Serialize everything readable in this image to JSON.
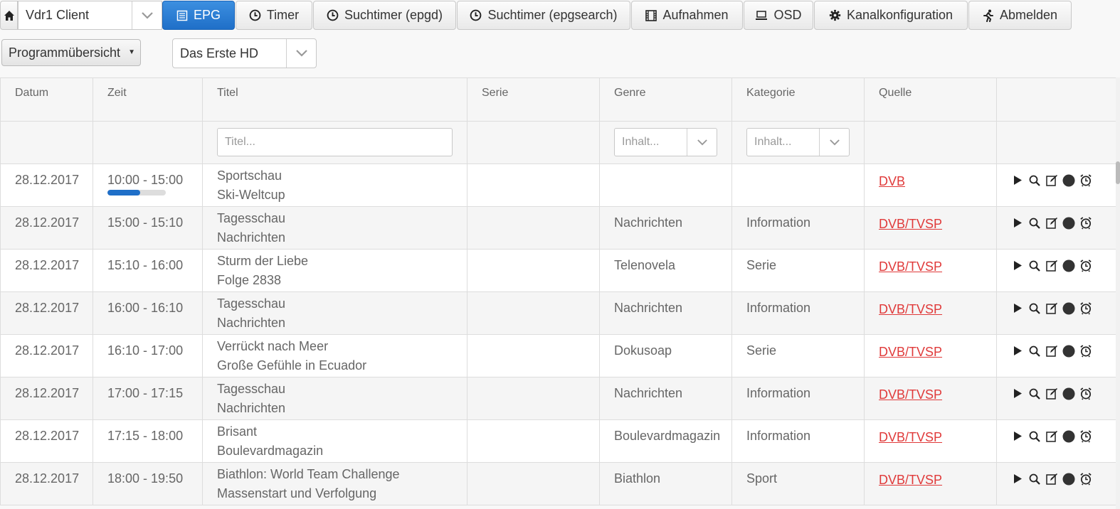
{
  "nav": {
    "client_select": "Vdr1 Client",
    "buttons": {
      "epg": "EPG",
      "timer": "Timer",
      "suchtimer_epgd": "Suchtimer (epgd)",
      "suchtimer_epgsearch": "Suchtimer (epgsearch)",
      "aufnahmen": "Aufnahmen",
      "osd": "OSD",
      "kanalkonfiguration": "Kanalkonfiguration",
      "abmelden": "Abmelden"
    }
  },
  "view_select": "Programmübersicht",
  "channel_select": "Das Erste HD",
  "table": {
    "headers": {
      "datum": "Datum",
      "zeit": "Zeit",
      "titel": "Titel",
      "serie": "Serie",
      "genre": "Genre",
      "kategorie": "Kategorie",
      "quelle": "Quelle"
    },
    "filters": {
      "titel_placeholder": "Titel...",
      "genre_placeholder": "Inhalt...",
      "kategorie_placeholder": "Inhalt..."
    },
    "rows": [
      {
        "datum": "28.12.2017",
        "zeit": "10:00 - 15:00",
        "progress": 0.56,
        "titel": "Sportschau",
        "untertitel": "Ski-Weltcup",
        "serie": "",
        "genre": "",
        "kategorie": "",
        "quelle": "DVB"
      },
      {
        "datum": "28.12.2017",
        "zeit": "15:00 - 15:10",
        "titel": "Tagesschau",
        "untertitel": "Nachrichten",
        "serie": "",
        "genre": "Nachrichten",
        "kategorie": "Information",
        "quelle": "DVB/TVSP"
      },
      {
        "datum": "28.12.2017",
        "zeit": "15:10 - 16:00",
        "titel": "Sturm der Liebe",
        "untertitel": "Folge 2838",
        "serie": "",
        "genre": "Telenovela",
        "kategorie": "Serie",
        "quelle": "DVB/TVSP"
      },
      {
        "datum": "28.12.2017",
        "zeit": "16:00 - 16:10",
        "titel": "Tagesschau",
        "untertitel": "Nachrichten",
        "serie": "",
        "genre": "Nachrichten",
        "kategorie": "Information",
        "quelle": "DVB/TVSP"
      },
      {
        "datum": "28.12.2017",
        "zeit": "16:10 - 17:00",
        "titel": "Verrückt nach Meer",
        "untertitel": "Große Gefühle in Ecuador",
        "serie": "",
        "genre": "Dokusoap",
        "kategorie": "Serie",
        "quelle": "DVB/TVSP"
      },
      {
        "datum": "28.12.2017",
        "zeit": "17:00 - 17:15",
        "titel": "Tagesschau",
        "untertitel": "Nachrichten",
        "serie": "",
        "genre": "Nachrichten",
        "kategorie": "Information",
        "quelle": "DVB/TVSP"
      },
      {
        "datum": "28.12.2017",
        "zeit": "17:15 - 18:00",
        "titel": "Brisant",
        "untertitel": "Boulevardmagazin",
        "serie": "",
        "genre": "Boulevardmagazin",
        "kategorie": "Information",
        "quelle": "DVB/TVSP"
      },
      {
        "datum": "28.12.2017",
        "zeit": "18:00 - 19:50",
        "titel": "Biathlon: World Team Challenge",
        "untertitel": "Massenstart und Verfolgung",
        "serie": "",
        "genre": "Biathlon",
        "kategorie": "Sport",
        "quelle": "DVB/TVSP"
      }
    ],
    "row_actions": [
      "play-icon",
      "search-icon",
      "edit-icon",
      "record-icon",
      "alarm-clock-icon"
    ]
  },
  "colors": {
    "accent": "#1f6fc8",
    "link": "#e03a3a"
  }
}
